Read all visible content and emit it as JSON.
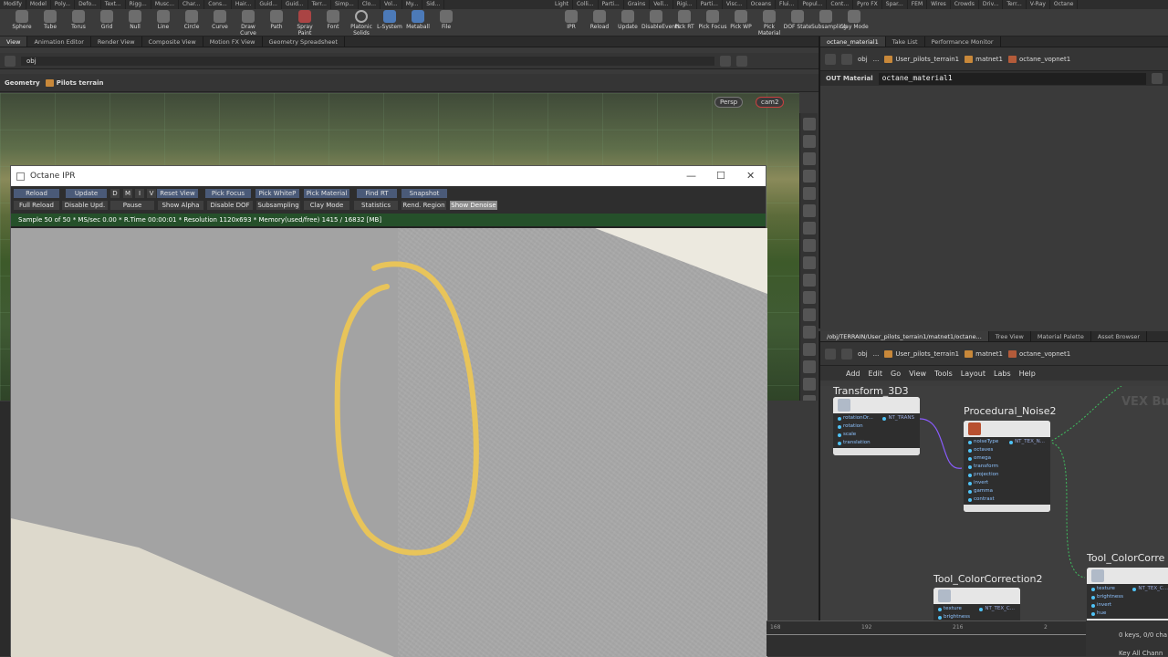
{
  "shelf": {
    "tabs": [
      "Modify",
      "Model",
      "Poly...",
      "Defo...",
      "Text...",
      "Rigg...",
      "Musc...",
      "Char...",
      "Cons...",
      "Hair...",
      "Guid...",
      "Guid...",
      "Terr...",
      "Simp...",
      "Clo...",
      "Vol...",
      "My...",
      "Sid..."
    ],
    "tabs_right": [
      "Light",
      "Colli...",
      "Parti...",
      "Grains",
      "Vell...",
      "Rigi...",
      "Parti...",
      "Visc...",
      "Oceans",
      "Flui...",
      "Popul...",
      "Cont...",
      "Pyro FX",
      "Spar...",
      "FEM",
      "Wires",
      "Crowds",
      "Driv...",
      "Terr...",
      "V-Ray",
      "Octane"
    ],
    "tools": [
      "Sphere",
      "Tube",
      "Torus",
      "Grid",
      "Null",
      "Line",
      "Circle",
      "Curve",
      "Draw Curve",
      "Path",
      "Spray Paint",
      "Font",
      "Platonic Solids",
      "L-System",
      "Metaball",
      "File"
    ],
    "tools_right": [
      "IPR",
      "Reload",
      "Update",
      "DisableEvents",
      "Pick RT",
      "Pick Focus",
      "Pick WP",
      "Pick Material",
      "DOF State",
      "Subsampling",
      "Clay Mode"
    ]
  },
  "left_tabs": [
    "View",
    "Animation Editor",
    "Render View",
    "Composite View",
    "Motion FX View",
    "Geometry Spreadsheet"
  ],
  "left_path": "obj",
  "viewport": {
    "context": "Geometry",
    "node": "Pilots terrain",
    "persp": "Persp",
    "camera": "cam2"
  },
  "ipr": {
    "title": "Octane IPR",
    "buttons_row1": [
      "Reload",
      "Update",
      "D",
      "M",
      "I",
      "V",
      "Reset View",
      "Pick Focus",
      "Pick WhiteP",
      "Pick Material",
      "Find RT",
      "Snapshot"
    ],
    "buttons_row2": [
      "Full Reload",
      "Disable Upd.",
      "Pause",
      "Show Alpha",
      "Disable DOF",
      "Subsampling",
      "Clay Mode",
      "Statistics",
      "Rend. Region",
      "Show Denoise"
    ],
    "status": "Sample 50 of 50 * MS/sec 0.00 * R.Time 00:00:01 * Resolution 1120x693 * Memory(used/free) 1415 / 16832 [MB]"
  },
  "right_top": {
    "tabs": [
      "octane_material1",
      "Take List",
      "Performance Monitor"
    ],
    "path": [
      "obj",
      "...",
      "User_pilots_terrain1",
      "matnet1",
      "octane_vopnet1"
    ],
    "param_label": "OUT Material",
    "param_value": "octane_material1"
  },
  "right_bottom": {
    "tabs": [
      "/obj/TERRAIN/User_pilots_terrain1/matnet1/octane...",
      "Tree View",
      "Material Palette",
      "Asset Browser"
    ],
    "path": [
      "obj",
      "...",
      "User_pilots_terrain1",
      "matnet1",
      "octane_vopnet1"
    ],
    "menu": [
      "Add",
      "Edit",
      "Go",
      "View",
      "Tools",
      "Layout",
      "Labs",
      "Help"
    ],
    "watermark": "VEX Bu",
    "nodes": [
      {
        "name": "Transform_3D3",
        "inputs": [
          "rotationOr...",
          "rotation",
          "scale",
          "translation"
        ],
        "output": "NT_TRANS"
      },
      {
        "name": "Procedural_Noise2",
        "inputs": [
          "noiseType",
          "octaves",
          "omega",
          "transform",
          "projection",
          "invert",
          "gamma",
          "contrast"
        ],
        "output": "NT_TEX_N..."
      },
      {
        "name": "Tool_ColorCorrection2",
        "inputs": [
          "texture",
          "brightness"
        ],
        "output": "NT_TEX_C..."
      },
      {
        "name": "Tool_ColorCorre",
        "inputs": [
          "texture",
          "brightness",
          "invert",
          "hue"
        ],
        "output": "NT_TEX_C..."
      }
    ]
  },
  "timeline": {
    "ticks": [
      "168",
      "192",
      "216",
      "2"
    ],
    "keys": "0 keys, 0/0 cha",
    "key_all": "Key All Chann"
  },
  "colors": {
    "annotation": "#e8c45a",
    "status_bar": "#25502a",
    "accent_blue": "#4a5a78"
  }
}
